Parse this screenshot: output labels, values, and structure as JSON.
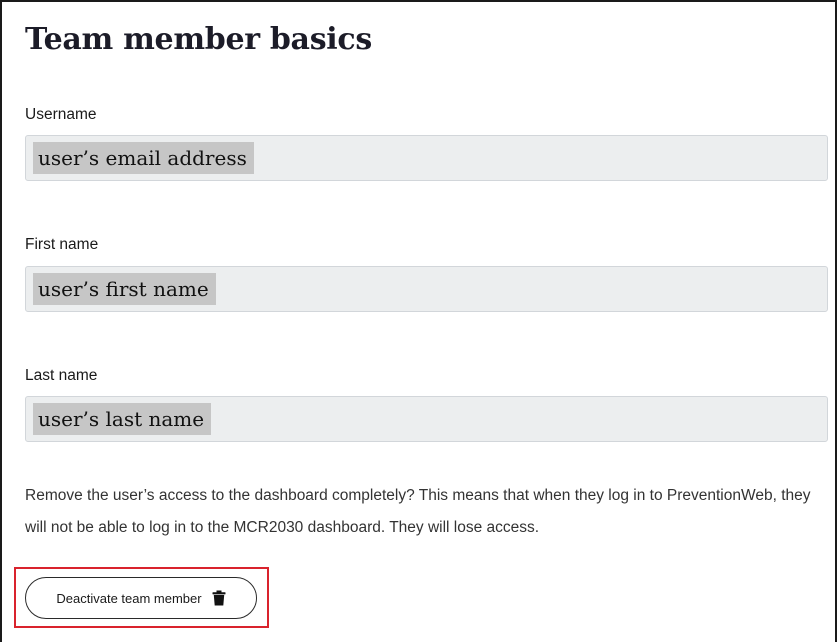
{
  "page": {
    "title": "Team member basics"
  },
  "fields": {
    "username": {
      "label": "Username",
      "value": "user’s email address"
    },
    "first_name": {
      "label": "First name",
      "value": "user’s first name"
    },
    "last_name": {
      "label": "Last name",
      "value": "user’s last name"
    }
  },
  "deactivate": {
    "description": "Remove the user’s access to the dashboard completely? This means that when they log in to PreventionWeb, they will not be able to log in to the MCR2030 dashboard. They will lose access.",
    "button_label": "Deactivate team member",
    "button_icon": "trash-icon"
  },
  "colors": {
    "highlight": "#d9232d",
    "field_background": "#eceeef",
    "value_highlight": "#c6c6c6"
  }
}
